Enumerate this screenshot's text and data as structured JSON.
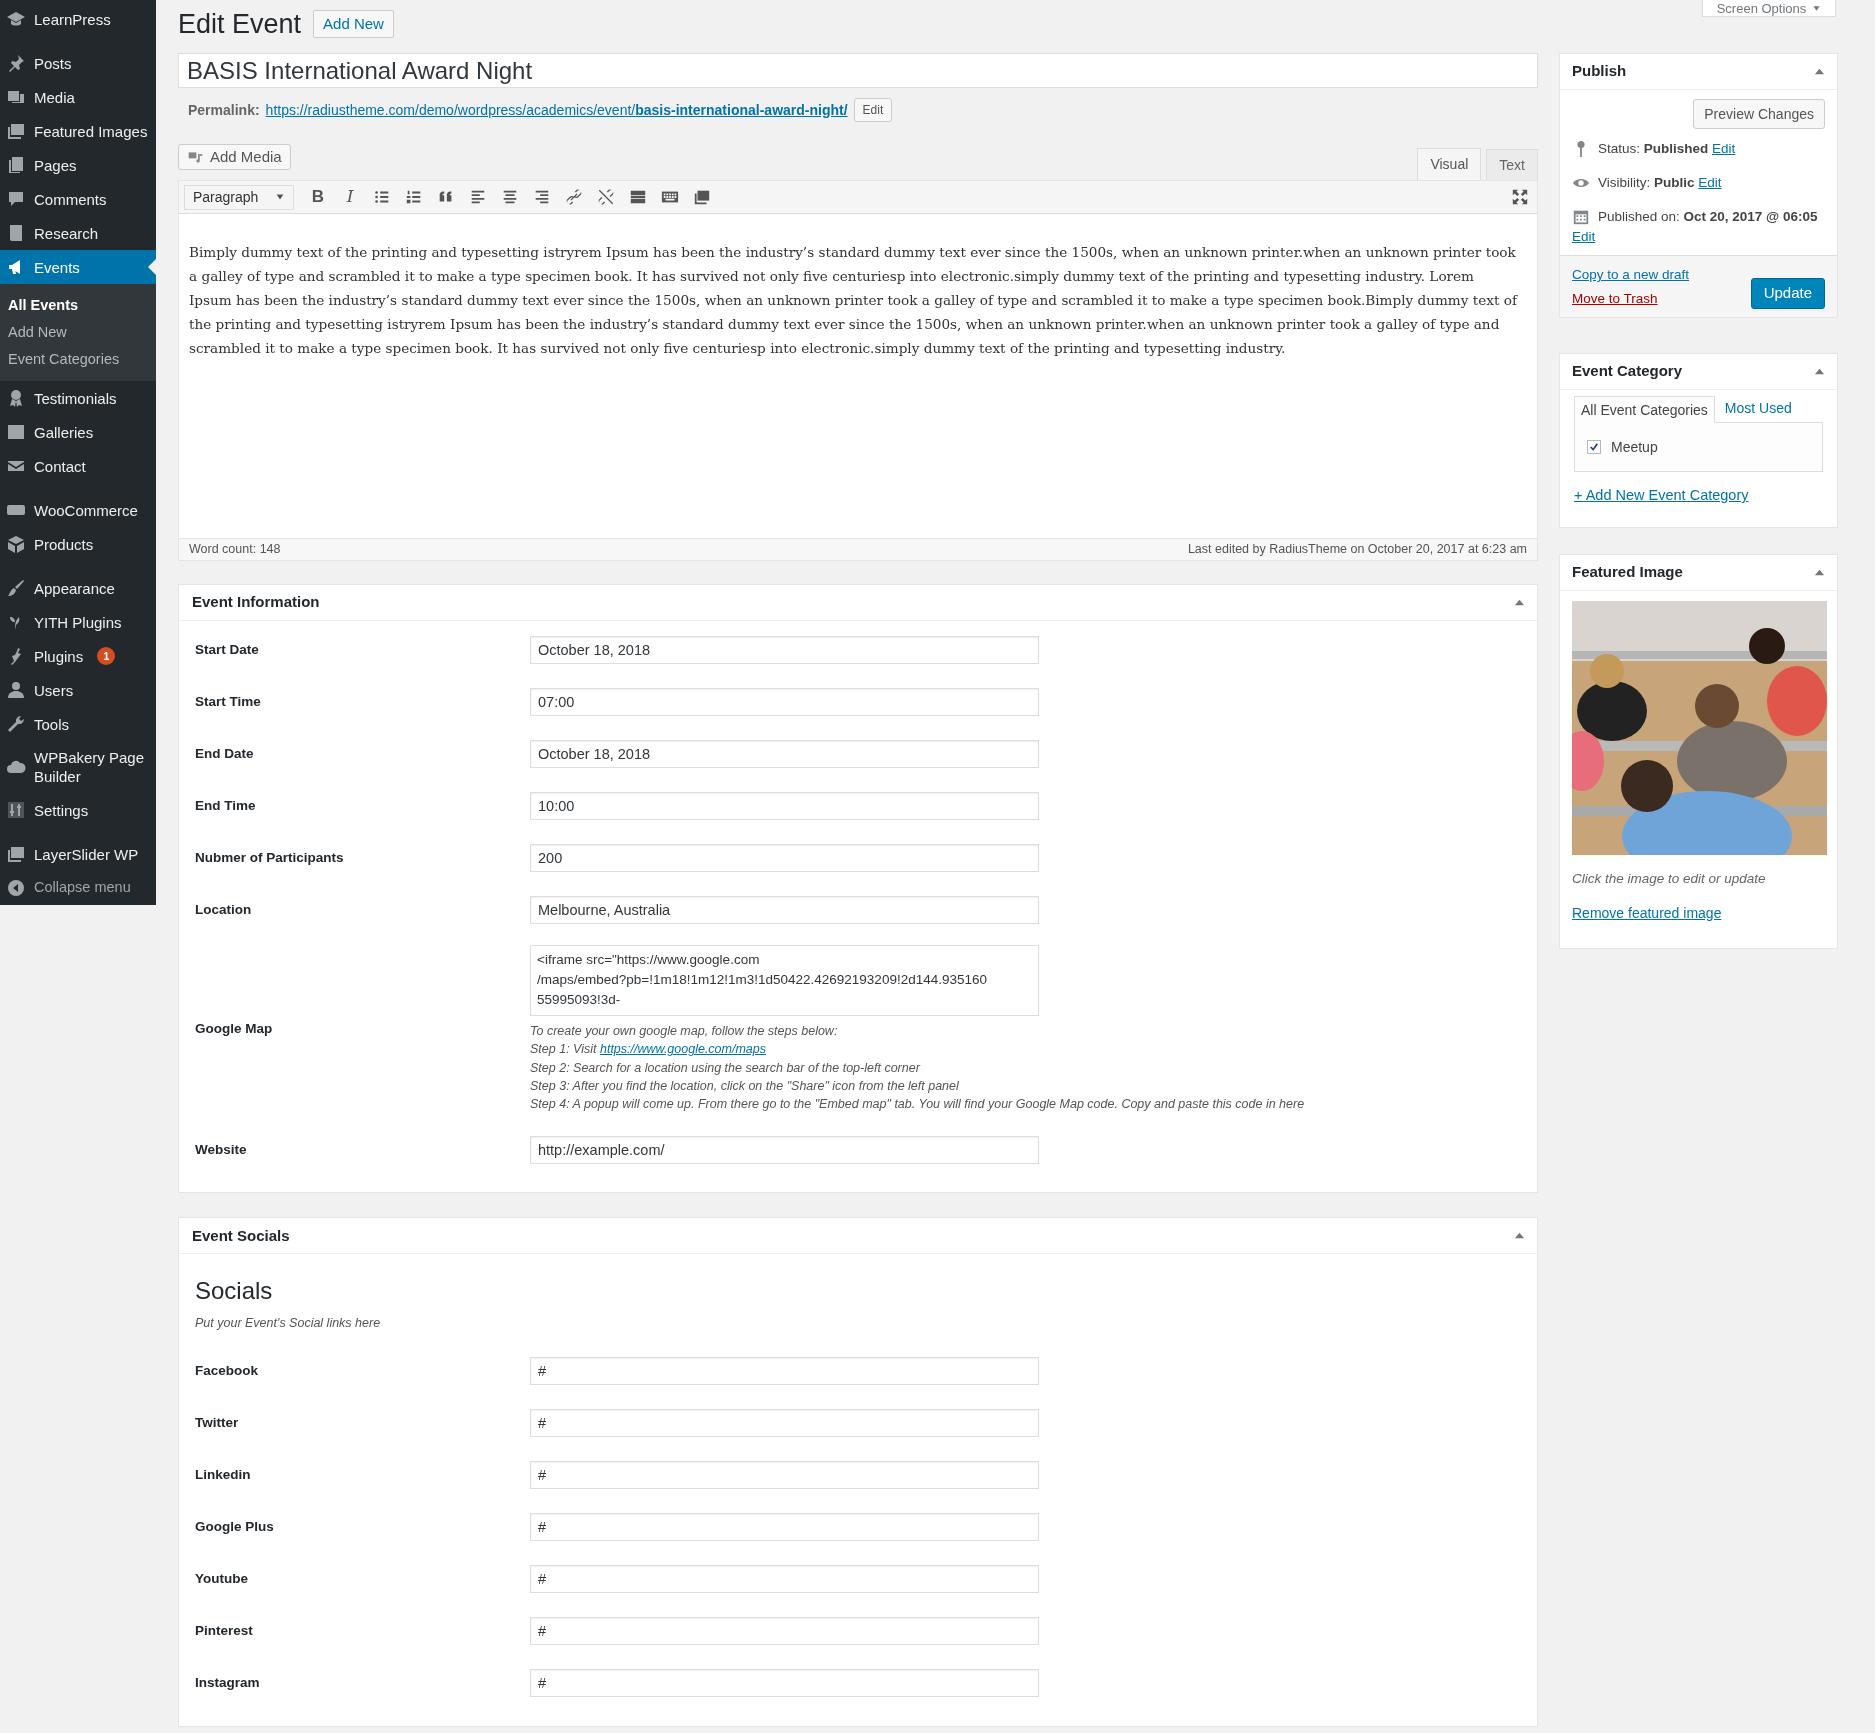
{
  "sidebar": {
    "groups": [
      [
        {
          "label": "LearnPress",
          "selected": false
        }
      ],
      [
        {
          "label": "Posts",
          "selected": false
        },
        {
          "label": "Media",
          "selected": false
        },
        {
          "label": "Featured Images",
          "selected": false
        },
        {
          "label": "Pages",
          "selected": false
        },
        {
          "label": "Comments",
          "selected": false
        },
        {
          "label": "Research",
          "selected": false
        },
        {
          "label": "Events",
          "selected": true,
          "children": [
            {
              "label": "All Events",
              "selected": true
            },
            {
              "label": "Add New",
              "selected": false
            },
            {
              "label": "Event Categories",
              "selected": false
            }
          ]
        },
        {
          "label": "Testimonials",
          "selected": false
        },
        {
          "label": "Galleries",
          "selected": false
        },
        {
          "label": "Contact",
          "selected": false
        }
      ],
      [
        {
          "label": "WooCommerce",
          "selected": false
        },
        {
          "label": "Products",
          "selected": false
        }
      ],
      [
        {
          "label": "Appearance",
          "selected": false
        },
        {
          "label": "YITH Plugins",
          "selected": false
        },
        {
          "label": "Plugins",
          "selected": false,
          "badge": "1"
        },
        {
          "label": "Users",
          "selected": false
        },
        {
          "label": "Tools",
          "selected": false
        },
        {
          "label": "WPBakery Page Builder",
          "selected": false
        },
        {
          "label": "Settings",
          "selected": false
        }
      ],
      [
        {
          "label": "LayerSlider WP",
          "selected": false
        }
      ]
    ],
    "collapse": "Collapse menu"
  },
  "screen_options": "Screen Options",
  "page_title": "Edit Event",
  "add_new": "Add New",
  "post_title": "BASIS International Award Night",
  "permalink": {
    "label": "Permalink:",
    "url": "https://radiustheme.com/demo/wordpress/academics/event/**basis-international-award-night/**",
    "edit": "Edit"
  },
  "editor": {
    "add_media": "Add Media",
    "tabs": [
      {
        "label": "Visual",
        "selected": true
      },
      {
        "label": "Text",
        "selected": false
      }
    ],
    "format": "Paragraph",
    "toolbar": [
      {
        "kind": "bold",
        "label": "B"
      },
      {
        "kind": "italic",
        "label": "I"
      },
      {
        "kind": "bullet-list"
      },
      {
        "kind": "numbered-list"
      },
      {
        "kind": "quote"
      },
      {
        "kind": "align-left"
      },
      {
        "kind": "align-center"
      },
      {
        "kind": "align-right"
      },
      {
        "kind": "link"
      },
      {
        "kind": "unlink"
      },
      {
        "kind": "read-more"
      },
      {
        "kind": "toolbar-toggle"
      },
      {
        "kind": "insert-image"
      }
    ],
    "content": "Bimply dummy text of the printing and typesetting istryrem Ipsum has been the industry’s standard dummy text ever since the 1500s, when an unknown printer.when an unknown printer took a galley of type and scrambled it to make a type specimen book. It has survived not only five centuriesp into electronic.simply dummy text of the printing and typesetting industry. Lorem Ipsum has been the industry’s standard dummy text ever since the 1500s, when an unknown printer took a galley of type and scrambled it to make a type specimen book.Bimply dummy text of the printing and typesetting istryrem Ipsum has been the industry’s standard dummy text ever since the 1500s, when an unknown printer.when an unknown printer took a galley of type and scrambled it to make a type specimen book. It has survived not only five centuriesp into electronic.simply dummy text of the printing and typesetting industry.",
    "word_count": "Word count: 148",
    "last_edited": "Last edited by RadiusTheme on October 20, 2017 at 6:23 am"
  },
  "event_information": {
    "title": "Event Information",
    "fields": [
      {
        "kind": "input",
        "label": "Start Date",
        "value": "October 18, 2018"
      },
      {
        "kind": "input",
        "label": "Start Time",
        "value": "07:00"
      },
      {
        "kind": "input",
        "label": "End Date",
        "value": "October 18, 2018"
      },
      {
        "kind": "input",
        "label": "End Time",
        "value": "10:00"
      },
      {
        "kind": "input",
        "label": "Nubmer of Participants",
        "value": "200"
      },
      {
        "kind": "input",
        "label": "Location",
        "value": "Melbourne, Australia"
      },
      {
        "kind": "textarea",
        "label": "Google Map",
        "value": "<iframe src=\"https://www.google.com\n/maps/embed?pb=!1m18!1m12!1m3!1d50422.42692193209!2d144.935160\n55995093!3d-",
        "help": [
          {
            "text": "To create your own google map, follow the steps below:"
          },
          {
            "text": "Step 1: Visit",
            "link": "https://www.google.com/maps"
          },
          {
            "text": "Step 2: Search for a location using the search bar of the top-left corner"
          },
          {
            "text": "Step 3: After you find the location, click on the \"Share\" icon from the left panel"
          },
          {
            "text": "Step 4: A popup will come up. From there go to the \"Embed map\" tab. You will find your Google Map code. Copy and paste this code in here"
          }
        ]
      },
      {
        "kind": "input",
        "label": "Website",
        "value": "http://example.com/"
      }
    ]
  },
  "event_socials": {
    "title": "Event Socials",
    "heading": "Socials",
    "description": "Put your Event's Social links here",
    "fields": [
      {
        "label": "Facebook",
        "value": "#"
      },
      {
        "label": "Twitter",
        "value": "#"
      },
      {
        "label": "Linkedin",
        "value": "#"
      },
      {
        "label": "Google Plus",
        "value": "#"
      },
      {
        "label": "Youtube",
        "value": "#"
      },
      {
        "label": "Pinterest",
        "value": "#"
      },
      {
        "label": "Instagram",
        "value": "#"
      }
    ]
  },
  "publish": {
    "title": "Publish",
    "preview": "Preview Changes",
    "status": "Status: **Published**",
    "visibility": "Visibility: **Public**",
    "published_on": "Published on: **Oct 20, 2017 @ 06:05**",
    "status_edit": "Edit",
    "visibility_edit": "Edit",
    "date_edit": "Edit",
    "copy_draft": "Copy to a new draft",
    "trash": "Move to Trash",
    "update": "Update"
  },
  "event_category": {
    "title": "Event Category",
    "tabs": [
      {
        "label": "All Event Categories",
        "selected": true
      },
      {
        "label": "Most Used",
        "selected": false
      }
    ],
    "items": [
      {
        "label": "Meetup",
        "checked": true
      }
    ],
    "add_new": "+ Add New Event Category"
  },
  "featured_image": {
    "title": "Featured Image",
    "caption": "Click the image to edit or update",
    "remove": "Remove featured image"
  }
}
